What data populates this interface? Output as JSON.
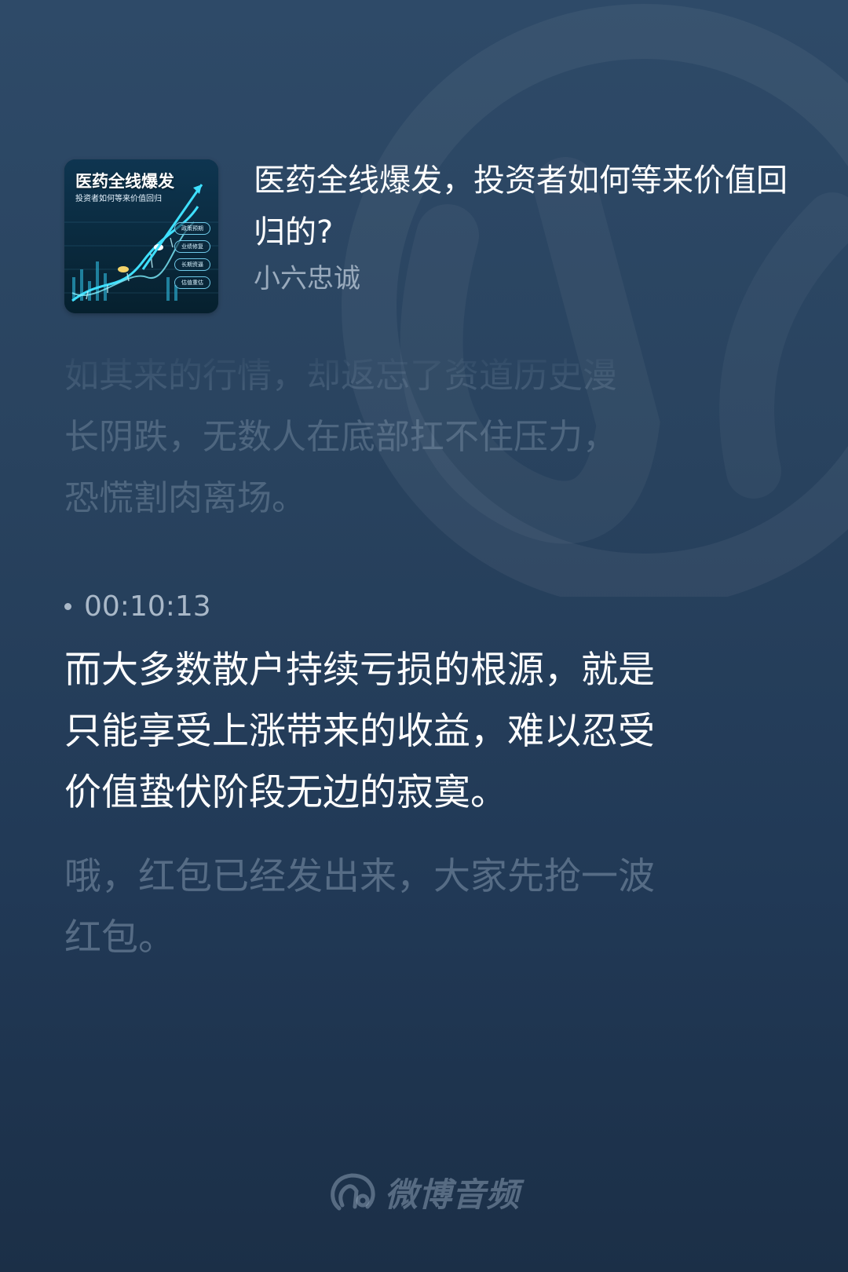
{
  "colors": {
    "background_top": "#2e4a68",
    "background_bottom": "#1b2f47",
    "title_text": "#ffffff",
    "author_text": "#9aabbd",
    "active_lyric": "#ffffff",
    "inactive_lyric": "#8ea0b3",
    "cover_accent": "#3fe0ff"
  },
  "episode": {
    "cover": {
      "title": "医药全线爆发",
      "subtitle": "投资者如何等来价值回归",
      "tags": [
        "政策预期",
        "业绩修复",
        "长期资逼",
        "估值重估"
      ]
    },
    "title": "医药全线爆发，投资者如何等来价值回归的?",
    "author": "小六忠诚"
  },
  "lyrics": {
    "previous_lines": [
      "如其来的行情，却返忘了资道历史漫",
      "长阴跌，无数人在底部扛不住压力，",
      "恐慌割肉离场。"
    ],
    "current": {
      "timestamp": "00:10:13",
      "lines": [
        "而大多数散户持续亏损的根源，就是",
        "只能享受上涨带来的收益，难以忍受",
        "价值蛰伏阶段无边的寂寞。"
      ]
    },
    "next_lines": [
      "哦，红包已经发出来，大家先抢一波",
      "红包。"
    ]
  },
  "brand": {
    "icon": "weibo-audio-icon",
    "name": "微博音频"
  }
}
